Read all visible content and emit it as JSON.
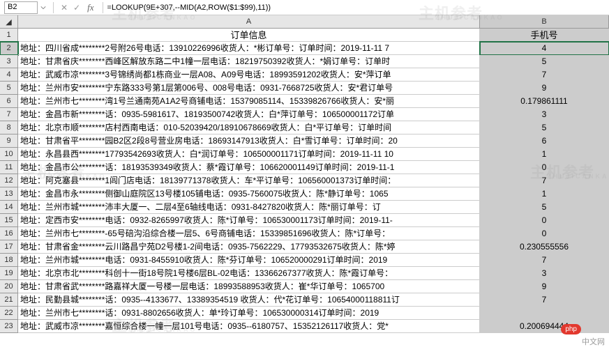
{
  "formula_bar": {
    "cell": "B2",
    "fx": "fx",
    "formula": "=LOOKUP(9E+307,--MID(A2,ROW($1:$99),11))"
  },
  "headers": {
    "A": "A",
    "B": "B"
  },
  "title_row": {
    "A": "订单信息",
    "B": "手机号"
  },
  "rows": [
    {
      "n": 2,
      "a": "地址：四川省成********2号附26号电话：13910226996收货人：*彬订单号：订单时间：2019-11-11 7",
      "b": "4"
    },
    {
      "n": 3,
      "a": "地址：甘肃省庆********西峰区解放东路二中1幢一层电话：18219750392收货人：*娟订单号：订单时",
      "b": "5"
    },
    {
      "n": 4,
      "a": "地址：武威市凉********3号锦绣尚都1栋商业一层A08、A09号电话：18993591202收货人：安*萍订单",
      "b": "7"
    },
    {
      "n": 5,
      "a": "地址：兰州市安********宁东路333号第1层第006号、008号电话：0931-7668725收货人：安*君订单号",
      "b": "9"
    },
    {
      "n": 6,
      "a": "地址：兰州市七********湾1号兰通南苑A1A2号商铺电话：15379085114、15339826766收货人：安*丽",
      "b": "0.179861111"
    },
    {
      "n": 7,
      "a": "地址：金昌市新********话：0935-5981617、18193500742收货人：白*萍订单号：106500001172订单",
      "b": "3"
    },
    {
      "n": 8,
      "a": "地址：北京市顺********店村西南电话：010-52039420/18910678669收货人：白*平订单号：订单时间",
      "b": "5"
    },
    {
      "n": 9,
      "a": "地址：甘肃省平********园B2区2段8号营业房电话：18693147913收货人：白*雪订单号：订单时间：20",
      "b": "6"
    },
    {
      "n": 10,
      "a": "地址：永昌县西********17793542693收货人：白*润订单号：106500001171订单时间：2019-11-11 10",
      "b": "1"
    },
    {
      "n": 11,
      "a": "地址：金昌市公********话：18193539349收货人：蔡*霞订单号：106620001149订单时间：2019-11-1",
      "b": "0"
    },
    {
      "n": 12,
      "a": "地址：阿克塞县********1闾门店电话：18139771378收货人：车*平订单号：106560001373订单时间：",
      "b": "7"
    },
    {
      "n": 13,
      "a": "地址：金昌市永********侧御山庭院区13号楼105铺电话：0935-7560075收货人：陈*静订单号：1065",
      "b": "1"
    },
    {
      "n": 14,
      "a": "地址：兰州市城********沛丰大厦一、二层4至6轴线电话：0931-8427820收货人：陈*丽订单号：订",
      "b": "5"
    },
    {
      "n": 15,
      "a": "地址：定西市安********电话：0932-8265997收货人：陈*订单号：106530001173订单时间：2019-11-",
      "b": "0"
    },
    {
      "n": 16,
      "a": "地址：兰州市七********-65号碚沟沿综合楼一层5、6号商铺电话：15339851696收货人：陈*订单号：",
      "b": "0"
    },
    {
      "n": 17,
      "a": "地址：甘肃省金********云川路昌宁苑D2号楼1-2间电话：0935-7562229、17793532675收货人：陈*婷",
      "b": "0.230555556"
    },
    {
      "n": 18,
      "a": "地址：兰州市城********电话：0931-8455910收货人：陈*芬订单号：106520000291订单时间：2019",
      "b": "7"
    },
    {
      "n": 19,
      "a": "地址：北京市北********科创十一街18号院1号楼6层BL-02电话：13366267377收货人：陈*霞订单号：",
      "b": "3"
    },
    {
      "n": 20,
      "a": "地址：甘肃省武********路嘉祥大厦一号楼一层电话：18993588953收货人：崔*华订单号：1065700",
      "b": "9"
    },
    {
      "n": 21,
      "a": "地址：民勤县城********话：0935--4133677、13389354519 收货人：代*花订单号：10654000118811订",
      "b": "7"
    },
    {
      "n": 22,
      "a": "地址：兰州市七********话：0931-8802656收货人：单*玲订单号：106530000314订单时间：2019",
      "b": ""
    },
    {
      "n": 23,
      "a": "地址：武威市凉********嘉恒综合楼一幢一层101号电话：0935--6180757、15352126117收货人：党*",
      "b": "0.200694444"
    }
  ],
  "watermark": {
    "main": "主机参考",
    "sub": "ZHUJICANKAO"
  },
  "badge": {
    "php": "php",
    "cn": "中文网"
  }
}
